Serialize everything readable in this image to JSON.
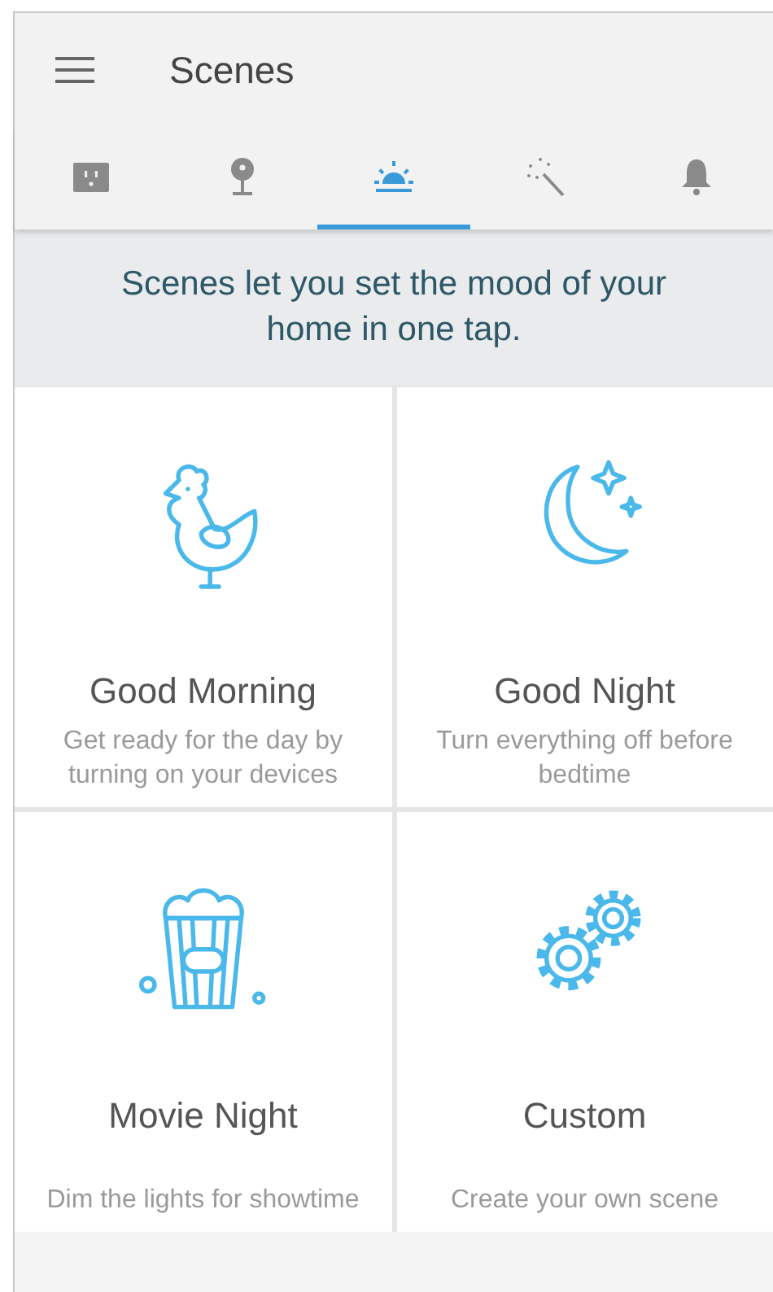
{
  "app_bar": {
    "title": "Scenes"
  },
  "tabs": [
    {
      "kind": "outlet",
      "selected": false
    },
    {
      "kind": "camera",
      "selected": false
    },
    {
      "kind": "sunrise",
      "selected": true
    },
    {
      "kind": "wand",
      "selected": false
    },
    {
      "kind": "bell",
      "selected": false
    }
  ],
  "banner": "Scenes let you set the mood of your home in one tap.",
  "scenes": [
    {
      "kind": "rooster",
      "title": "Good Morning",
      "description": "Get ready for the day by turning on your devices"
    },
    {
      "kind": "moon",
      "title": "Good Night",
      "description": "Turn everything off before bedtime"
    },
    {
      "kind": "popcorn",
      "title": "Movie Night",
      "description": "Dim the lights for showtime"
    },
    {
      "kind": "gears",
      "title": "Custom",
      "description": "Create your own scene"
    }
  ]
}
